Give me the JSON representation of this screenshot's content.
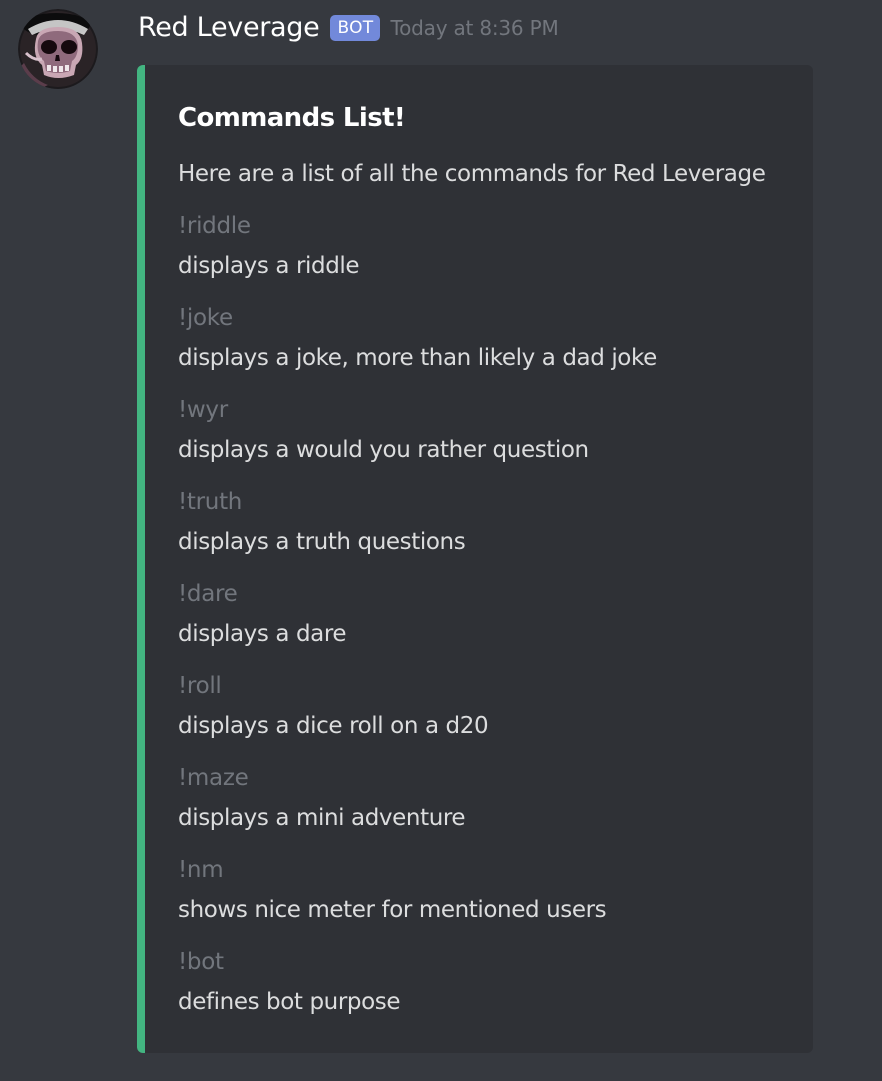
{
  "message": {
    "author": {
      "name": "Red Leverage",
      "tag": "BOT",
      "avatar_icon": "skull-avatar-icon"
    },
    "timestamp": "Today at 8:36 PM",
    "embed": {
      "accent_color": "#43b581",
      "title": "Commands List!",
      "description": "Here are a list of all the commands for Red Leverage",
      "fields": [
        {
          "name": "!riddle",
          "value": "displays a riddle"
        },
        {
          "name": "!joke",
          "value": "displays a joke, more than likely a dad joke"
        },
        {
          "name": "!wyr",
          "value": "displays a would you rather question"
        },
        {
          "name": "!truth",
          "value": "displays a truth questions"
        },
        {
          "name": "!dare",
          "value": "displays a dare"
        },
        {
          "name": "!roll",
          "value": "displays a dice roll on a d20"
        },
        {
          "name": "!maze",
          "value": "displays a mini adventure"
        },
        {
          "name": "!nm",
          "value": "shows nice meter for mentioned users"
        },
        {
          "name": "!bot",
          "value": "defines bot purpose"
        }
      ]
    }
  },
  "colors": {
    "background": "#36393f",
    "embed_background": "#2f3136",
    "bot_tag": "#7289da",
    "muted_text": "#72767d",
    "body_text": "#dcddde"
  }
}
